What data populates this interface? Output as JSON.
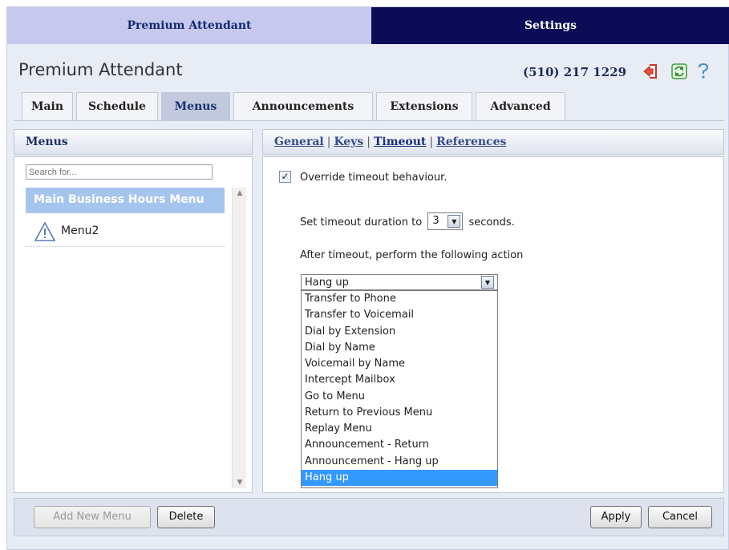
{
  "top_tabs": {
    "attendant": "Premium Attendant",
    "settings": "Settings"
  },
  "header": {
    "title": "Premium Attendant",
    "phone": "(510) 217 1229",
    "icons": [
      "logout-icon",
      "refresh-icon",
      "help-icon"
    ]
  },
  "tabs": [
    {
      "label": "Main"
    },
    {
      "label": "Schedule"
    },
    {
      "label": "Menus",
      "active": true
    },
    {
      "label": "Announcements"
    },
    {
      "label": "Extensions"
    },
    {
      "label": "Advanced"
    }
  ],
  "left": {
    "heading": "Menus",
    "search_placeholder": "Search for...",
    "items": [
      {
        "label": "Main Business Hours Menu",
        "selected": true
      },
      {
        "label": "Menu2",
        "icon": "warning-icon"
      }
    ]
  },
  "right": {
    "subnav": [
      "General",
      "Keys",
      "Timeout",
      "References"
    ],
    "subnav_active": "Timeout",
    "override_label": "Override timeout behaviour.",
    "override_checked": "✓",
    "duration_prefix": "Set timeout duration to",
    "duration_value": "3",
    "duration_suffix": "seconds.",
    "after_label": "After timeout, perform the following action",
    "action_value": "Hang up",
    "options": [
      "Transfer to Phone",
      "Transfer to Voicemail",
      "Dial by Extension",
      "Dial by Name",
      "Voicemail by Name",
      "Intercept Mailbox",
      "Go to Menu",
      "Return to Previous Menu",
      "Replay Menu",
      "Announcement - Return",
      "Announcement - Hang up",
      "Hang up"
    ],
    "highlighted_option": "Hang up"
  },
  "footer": {
    "add_new_menu": "Add New Menu",
    "delete": "Delete",
    "apply": "Apply",
    "cancel": "Cancel"
  },
  "colors": {
    "settings_tab_bg": "#0b0b56",
    "attendant_tab_bg": "#c6c8ee",
    "selected_item_bg": "#a6c5ee",
    "highlight_option_bg": "#3399ff"
  }
}
